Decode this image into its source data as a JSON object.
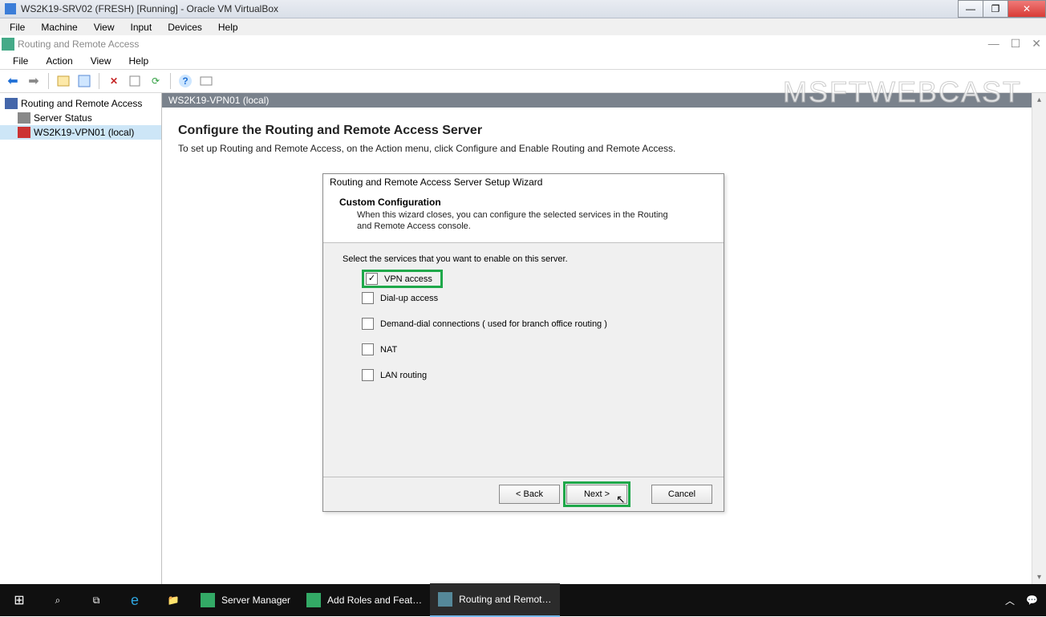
{
  "virtualbox": {
    "title": "WS2K19-SRV02 (FRESH) [Running] - Oracle VM VirtualBox",
    "menu": [
      "File",
      "Machine",
      "View",
      "Input",
      "Devices",
      "Help"
    ]
  },
  "watermark": "MSFTWEBCAST",
  "mmc": {
    "title": "Routing and Remote Access",
    "menu": [
      "File",
      "Action",
      "View",
      "Help"
    ],
    "tree": {
      "root": "Routing and Remote Access",
      "status": "Server Status",
      "server": "WS2K19-VPN01 (local)"
    },
    "content": {
      "header": "WS2K19-VPN01 (local)",
      "title": "Configure the Routing and Remote Access Server",
      "subtitle": "To set up Routing and Remote Access, on the Action menu, click Configure and Enable Routing and Remote Access."
    }
  },
  "wizard": {
    "title": "Routing and Remote Access Server Setup Wizard",
    "header_title": "Custom Configuration",
    "header_sub": "When this wizard closes, you can configure the selected services in the Routing and Remote Access console.",
    "body_intro": "Select the services that you want to enable on this server.",
    "options": {
      "vpn": "VPN access",
      "dialup": "Dial-up access",
      "demand": "Demand-dial connections ( used for branch office routing )",
      "nat": "NAT",
      "lan": "LAN routing"
    },
    "buttons": {
      "back": "< Back",
      "next": "Next >",
      "cancel": "Cancel"
    }
  },
  "taskbar": {
    "start": "⊞",
    "tasks": {
      "server_manager": "Server Manager",
      "add_roles": "Add Roles and Feat…",
      "rras": "Routing and Remot…"
    }
  }
}
